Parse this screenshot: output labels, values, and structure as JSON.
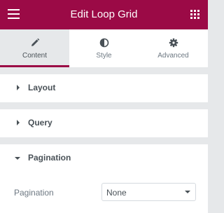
{
  "header": {
    "title": "Edit Loop Grid",
    "left_icon": "hamburger-menu-icon",
    "right_icon": "widgets-grid-icon",
    "color": "#9b0a46"
  },
  "tabs": [
    {
      "label": "Content",
      "icon": "pencil-icon",
      "active": true
    },
    {
      "label": "Style",
      "icon": "half-circle-icon",
      "active": false
    },
    {
      "label": "Advanced",
      "icon": "gear-icon",
      "active": false
    }
  ],
  "sections": [
    {
      "title": "Layout",
      "expanded": false
    },
    {
      "title": "Query",
      "expanded": false
    },
    {
      "title": "Pagination",
      "expanded": true
    }
  ],
  "pagination": {
    "label": "Pagination",
    "value": "None"
  }
}
